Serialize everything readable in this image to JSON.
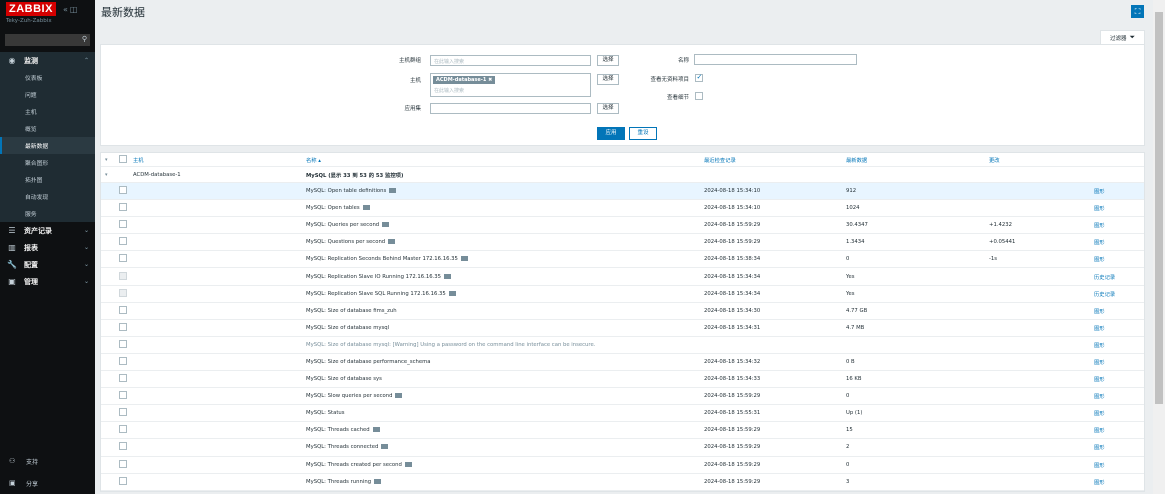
{
  "sidebar": {
    "logo": "ZABBIX",
    "server_name": "Teky-Zuh-Zabbix",
    "search_placeholder": "",
    "monitoring": {
      "label": "监测",
      "items": [
        "仪表板",
        "问题",
        "主机",
        "概览",
        "最新数据",
        "聚合图形",
        "拓扑图",
        "自动发现",
        "服务"
      ],
      "selected": "最新数据"
    },
    "sections": [
      {
        "label": "资产记录",
        "icon": "list-icon"
      },
      {
        "label": "报表",
        "icon": "chart-icon"
      },
      {
        "label": "配置",
        "icon": "wrench-icon"
      },
      {
        "label": "管理",
        "icon": "admin-icon"
      }
    ],
    "bottom": [
      {
        "label": "支持",
        "icon": "support-icon"
      },
      {
        "label": "分享",
        "icon": "share-icon"
      }
    ]
  },
  "header": {
    "title": "最新数据"
  },
  "filter": {
    "tab_label": "过滤器",
    "host_groups_label": "主机群组",
    "host_groups_placeholder": "在此输入搜索",
    "hosts_label": "主机",
    "host_tag": "ACDM-database-1",
    "hosts_placeholder": "在此输入搜索",
    "application_label": "应用集",
    "application_value": "",
    "select_label": "选择",
    "name_label": "名称",
    "name_value": "",
    "show_without_data_label": "查看无资料项目",
    "show_without_data": true,
    "show_details_label": "查看细节",
    "show_details": false,
    "apply_label": "应用",
    "reset_label": "重设"
  },
  "table": {
    "headers": {
      "host": "主机",
      "name": "名称 ▴",
      "last_check": "最近检查记录",
      "last_value": "最新数据",
      "change": "更改"
    },
    "host_group": {
      "host": "ACDM-database-1",
      "summary": "MySQL (显示 33 到 53 的 53 监控项)"
    },
    "rows": [
      {
        "name": "MySQL: Open table definitions",
        "flag": true,
        "time": "2024-08-18 15:34:10",
        "value": "912",
        "change": "",
        "link": "图形",
        "highlight": true,
        "cb_disabled": false,
        "muted": false
      },
      {
        "name": "MySQL: Open tables",
        "flag": true,
        "time": "2024-08-18 15:34:10",
        "value": "1024",
        "change": "",
        "link": "图形",
        "highlight": false,
        "cb_disabled": false,
        "muted": false
      },
      {
        "name": "MySQL: Queries per second",
        "flag": true,
        "time": "2024-08-18 15:59:29",
        "value": "30.4347",
        "change": "+1.4232",
        "link": "图形",
        "highlight": false,
        "cb_disabled": false,
        "muted": false
      },
      {
        "name": "MySQL: Questions per second",
        "flag": true,
        "time": "2024-08-18 15:59:29",
        "value": "1.3434",
        "change": "+0.05441",
        "link": "图形",
        "highlight": false,
        "cb_disabled": false,
        "muted": false
      },
      {
        "name": "MySQL: Replication Seconds Behind Master 172.16.16.35",
        "flag": true,
        "time": "2024-08-18 15:38:34",
        "value": "0",
        "change": "-1s",
        "link": "图形",
        "highlight": false,
        "cb_disabled": false,
        "muted": false
      },
      {
        "name": "MySQL: Replication Slave IO Running 172.16.16.35",
        "flag": true,
        "time": "2024-08-18 15:34:34",
        "value": "Yes",
        "change": "",
        "link": "历史记录",
        "highlight": false,
        "cb_disabled": true,
        "muted": false
      },
      {
        "name": "MySQL: Replication Slave SQL Running 172.16.16.35",
        "flag": true,
        "time": "2024-08-18 15:34:34",
        "value": "Yes",
        "change": "",
        "link": "历史记录",
        "highlight": false,
        "cb_disabled": true,
        "muted": false
      },
      {
        "name": "MySQL: Size of database fims_zuh",
        "flag": false,
        "time": "2024-08-18 15:34:30",
        "value": "4.77 GB",
        "change": "",
        "link": "图形",
        "highlight": false,
        "cb_disabled": false,
        "muted": false
      },
      {
        "name": "MySQL: Size of database mysql",
        "flag": false,
        "time": "2024-08-18 15:34:31",
        "value": "4.7 MB",
        "change": "",
        "link": "图形",
        "highlight": false,
        "cb_disabled": false,
        "muted": false
      },
      {
        "name": "MySQL: Size of database mysql: [Warning] Using a password on the command line interface can be insecure.",
        "flag": false,
        "time": "",
        "value": "",
        "change": "",
        "link": "图形",
        "highlight": false,
        "cb_disabled": false,
        "muted": true
      },
      {
        "name": "MySQL: Size of database performance_schema",
        "flag": false,
        "time": "2024-08-18 15:34:32",
        "value": "0 B",
        "change": "",
        "link": "图形",
        "highlight": false,
        "cb_disabled": false,
        "muted": false
      },
      {
        "name": "MySQL: Size of database sys",
        "flag": false,
        "time": "2024-08-18 15:34:33",
        "value": "16 KB",
        "change": "",
        "link": "图形",
        "highlight": false,
        "cb_disabled": false,
        "muted": false
      },
      {
        "name": "MySQL: Slow queries per second",
        "flag": true,
        "time": "2024-08-18 15:59:29",
        "value": "0",
        "change": "",
        "link": "图形",
        "highlight": false,
        "cb_disabled": false,
        "muted": false
      },
      {
        "name": "MySQL: Status",
        "flag": false,
        "time": "2024-08-18 15:55:31",
        "value": "Up (1)",
        "change": "",
        "link": "图形",
        "highlight": false,
        "cb_disabled": false,
        "muted": false
      },
      {
        "name": "MySQL: Threads cached",
        "flag": true,
        "time": "2024-08-18 15:59:29",
        "value": "15",
        "change": "",
        "link": "图形",
        "highlight": false,
        "cb_disabled": false,
        "muted": false
      },
      {
        "name": "MySQL: Threads connected",
        "flag": true,
        "time": "2024-08-18 15:59:29",
        "value": "2",
        "change": "",
        "link": "图形",
        "highlight": false,
        "cb_disabled": false,
        "muted": false
      },
      {
        "name": "MySQL: Threads created per second",
        "flag": true,
        "time": "2024-08-18 15:59:29",
        "value": "0",
        "change": "",
        "link": "图形",
        "highlight": false,
        "cb_disabled": false,
        "muted": false
      },
      {
        "name": "MySQL: Threads running",
        "flag": true,
        "time": "2024-08-18 15:59:29",
        "value": "3",
        "change": "",
        "link": "图形",
        "highlight": false,
        "cb_disabled": false,
        "muted": false
      }
    ]
  },
  "colors": {
    "accent": "#0275b8",
    "sidebar_bg": "#0e1012",
    "logo_red": "#d40000"
  }
}
